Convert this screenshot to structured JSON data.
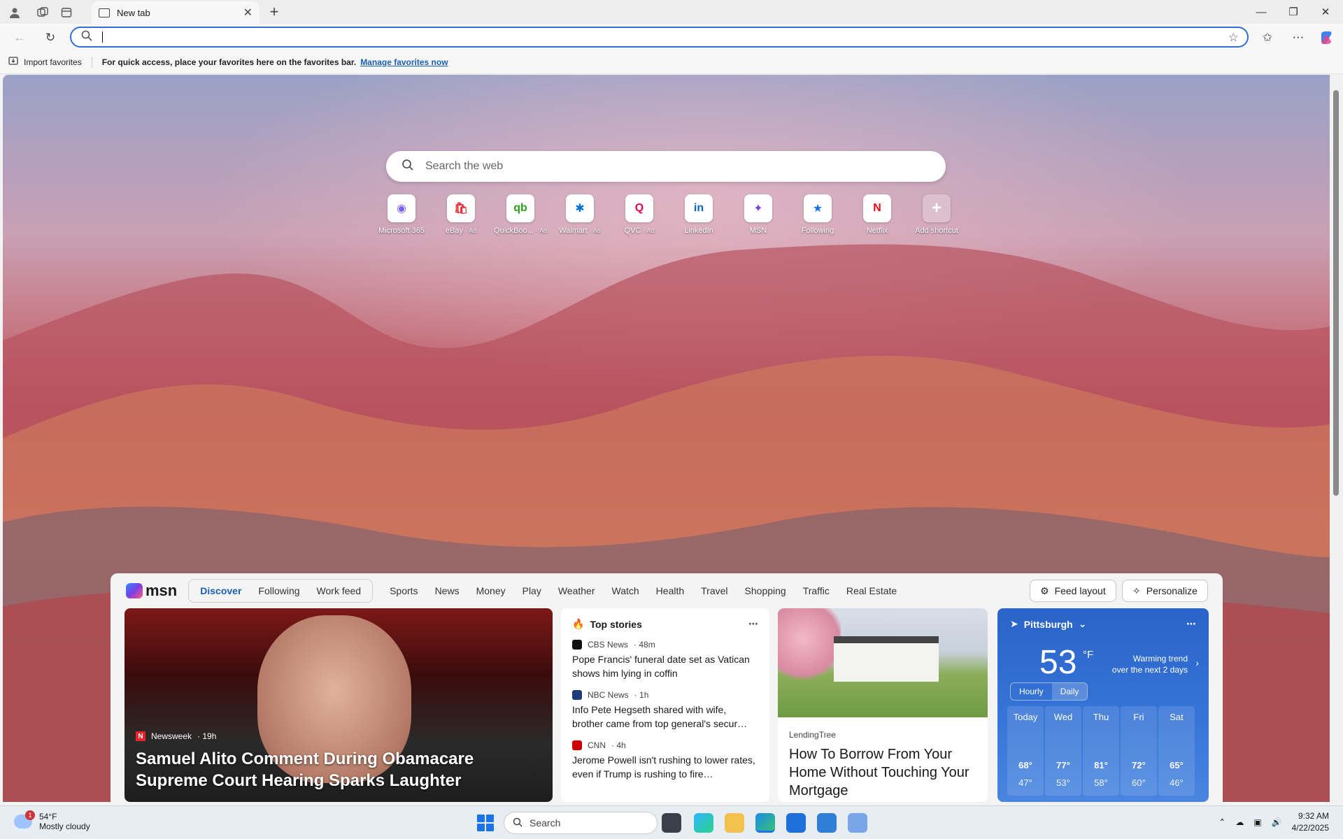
{
  "browser": {
    "tab_title": "New tab",
    "address_value": "",
    "favbar": {
      "import_label": "Import favorites",
      "hint": "For quick access, place your favorites here on the favorites bar.",
      "manage_label": "Manage favorites now"
    }
  },
  "newtab": {
    "search_placeholder": "Search the web",
    "shortcuts": [
      {
        "label": "Microsoft 365",
        "ad": "",
        "icon": "microsoft-365-icon",
        "color": "#7b5cff",
        "glyph": "◉"
      },
      {
        "label": "eBay",
        "ad": "· Ad",
        "icon": "ebay-icon",
        "color": "#e53238",
        "glyph": "🛍"
      },
      {
        "label": "QuickBoo...",
        "ad": "· Ad",
        "icon": "quickbooks-icon",
        "color": "#2ca01c",
        "glyph": "qb"
      },
      {
        "label": "Walmart",
        "ad": "· Ad",
        "icon": "walmart-icon",
        "color": "#0071ce",
        "glyph": "✱"
      },
      {
        "label": "QVC",
        "ad": "· Ad",
        "icon": "qvc-icon",
        "color": "#e5004d",
        "glyph": "Q"
      },
      {
        "label": "LinkedIn",
        "ad": "",
        "icon": "linkedin-icon",
        "color": "#0a66c2",
        "glyph": "in"
      },
      {
        "label": "MSN",
        "ad": "",
        "icon": "msn-icon",
        "color": "#7b3fe4",
        "glyph": "✦"
      },
      {
        "label": "Following",
        "ad": "",
        "icon": "following-icon",
        "color": "#1a73e8",
        "glyph": "★"
      },
      {
        "label": "Netflix",
        "ad": "",
        "icon": "netflix-icon",
        "color": "#e50914",
        "glyph": "N"
      },
      {
        "label": "Add shortcut",
        "ad": "",
        "icon": "add-shortcut-icon",
        "color": "#ffffff",
        "glyph": "+"
      }
    ]
  },
  "feed": {
    "logo": "msn",
    "pill_tabs": [
      "Discover",
      "Following",
      "Work feed"
    ],
    "nav_tabs": [
      "Sports",
      "News",
      "Money",
      "Play",
      "Weather",
      "Watch",
      "Health",
      "Travel",
      "Shopping",
      "Traffic",
      "Real Estate"
    ],
    "feed_layout_label": "Feed layout",
    "personalize_label": "Personalize",
    "hero": {
      "source": "Newsweek",
      "age": "· 19h",
      "title": "Samuel Alito Comment During Obamacare Supreme Court Hearing Sparks Laughter"
    },
    "top_stories": {
      "header": "Top stories",
      "stories": [
        {
          "source": "CBS News",
          "age": "· 48m",
          "title": "Pope Francis' funeral date set as Vatican shows him lying in coffin",
          "color": "#111111"
        },
        {
          "source": "NBC News",
          "age": "· 1h",
          "title": "Info Pete Hegseth shared with wife, brother came from top general's secur…",
          "color": "#1f3b7a"
        },
        {
          "source": "CNN",
          "age": "· 4h",
          "title": "Jerome Powell isn't rushing to lower rates, even if Trump is rushing to fire…",
          "color": "#cc0000"
        }
      ]
    },
    "promo": {
      "source": "LendingTree",
      "title": "How To Borrow From Your Home Without Touching Your Mortgage"
    },
    "weather": {
      "location": "Pittsburgh",
      "temp": "53",
      "unit": "°F",
      "trend_line1": "Warming trend",
      "trend_line2": "over the next 2 days",
      "hourly_label": "Hourly",
      "daily_label": "Daily",
      "days": [
        {
          "name": "Today",
          "hi": "68°",
          "lo": "47°"
        },
        {
          "name": "Wed",
          "hi": "77°",
          "lo": "53°"
        },
        {
          "name": "Thu",
          "hi": "81°",
          "lo": "58°"
        },
        {
          "name": "Fri",
          "hi": "72°",
          "lo": "60°"
        },
        {
          "name": "Sat",
          "hi": "65°",
          "lo": "46°"
        }
      ]
    }
  },
  "taskbar": {
    "weather_temp": "54°F",
    "weather_desc": "Mostly cloudy",
    "weather_badge": "1",
    "search_label": "Search",
    "time": "9:32 AM",
    "date": "4/22/2025"
  }
}
